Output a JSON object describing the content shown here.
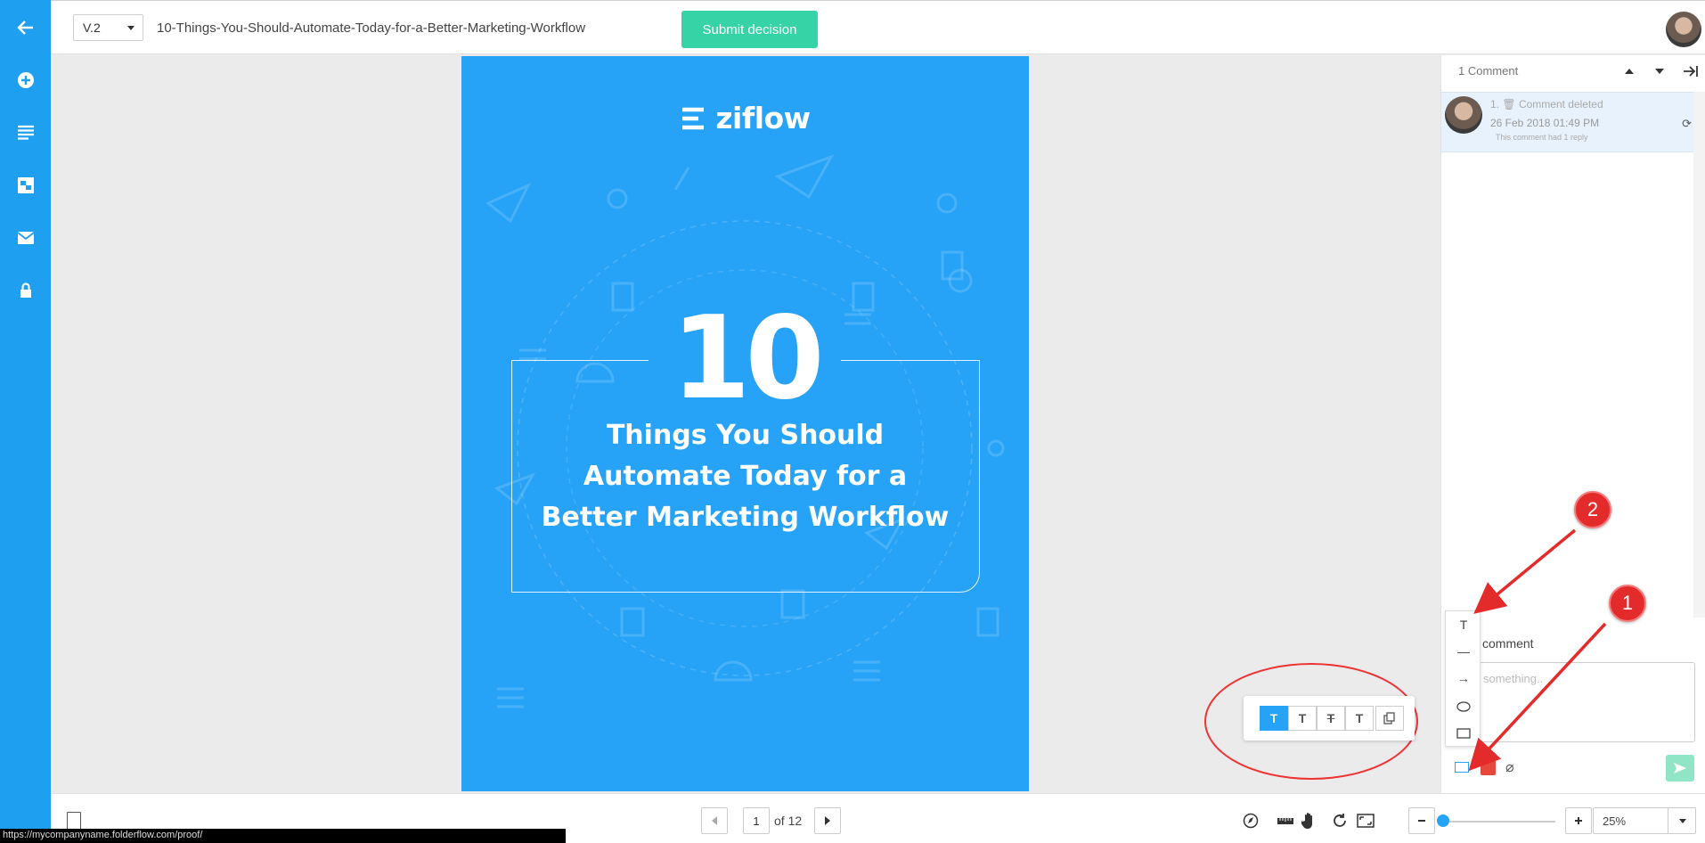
{
  "sidebar": {
    "items": [
      {
        "icon": "back-arrow-icon"
      },
      {
        "icon": "add-circle-icon"
      },
      {
        "icon": "list-icon"
      },
      {
        "icon": "compare-icon"
      },
      {
        "icon": "mail-icon"
      },
      {
        "icon": "lock-icon"
      }
    ],
    "color": "#1f9ff0"
  },
  "header": {
    "version": "V.2",
    "file_title": "10-Things-You-Should-Automate-Today-for-a-Better-Marketing-Workflow",
    "submit_label": "Submit decision",
    "submit_color": "#35d3a5"
  },
  "document": {
    "logo_text": "ziflow",
    "big_number": "10",
    "title_lines": [
      "Things You Should",
      "Automate Today for a",
      "Better Marketing Workflow"
    ],
    "background_color": "#26a2f7"
  },
  "text_toolbar": {
    "buttons": [
      "T",
      "T",
      "T",
      "T"
    ],
    "copy_icon": "copy-icon"
  },
  "comments": {
    "count_label": "1 Comment",
    "items": [
      {
        "number": "1.",
        "status": "Comment deleted",
        "date": "26 Feb 2018 01:49 PM",
        "reply_note": "This comment had 1 reply"
      }
    ],
    "heading": "comment",
    "placeholder": "something..",
    "shape_menu": [
      "T",
      "—",
      "→",
      "ellipse",
      "rectangle"
    ]
  },
  "annotations": {
    "badge_1": "1",
    "badge_2": "2"
  },
  "bottom_bar": {
    "page_current": "1",
    "page_total_label": "of 12",
    "zoom": "25%",
    "zoom_level": 0.0
  },
  "status_url": "https://mycompanyname.folderflow.com/proof/"
}
